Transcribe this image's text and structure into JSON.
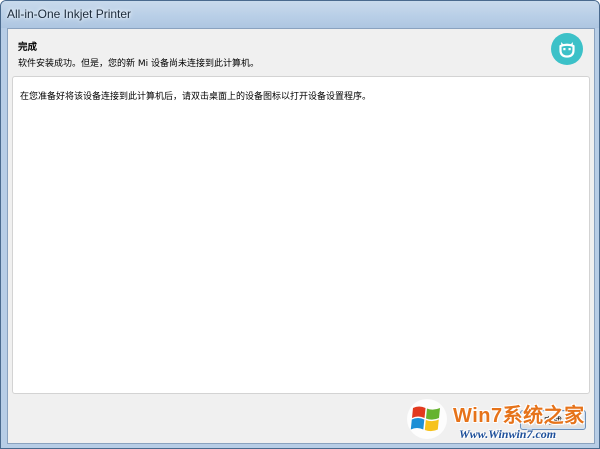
{
  "window": {
    "title": "All-in-One Inkjet Printer"
  },
  "header": {
    "title": "完成",
    "subtitle": "软件安装成功。但是，您的新 Mi 设备尚未连接到此计算机。",
    "logo_icon": "mi-logo-icon",
    "logo_color": "#3cc1c8"
  },
  "content": {
    "message": "在您准备好将该设备连接到此计算机后，请双击桌面上的设备图标以打开设备设置程序。"
  },
  "buttons": {
    "finish_label": "完成"
  },
  "watermark": {
    "brand": "Win7系统之家",
    "url": "Www.Winwin7.com",
    "icon": "windows-logo-icon"
  }
}
